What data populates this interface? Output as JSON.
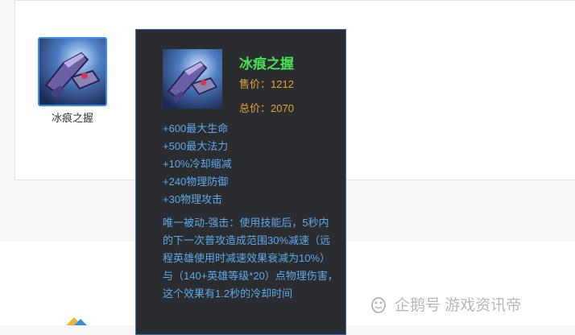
{
  "item": {
    "name": "冰痕之握",
    "icon": "ice-gauntlet-item-icon"
  },
  "tooltip": {
    "title": "冰痕之握",
    "sell_price": "售价：1212",
    "total_price": "总价：2070",
    "stats": [
      "+600最大生命",
      "+500最大法力",
      "+10%冷却缩减",
      "+240物理防御",
      "+30物理攻击"
    ],
    "passive": "唯一被动-强击：使用技能后，5秒内的下一次普攻造成范围30%减速（远程英雄使用时减速效果衰减为10%）与（140+英雄等级*20）点物理伤害，这个效果有1.2秒的冷却时间"
  },
  "watermark": {
    "text": "企鹅号 游戏资讯帝",
    "icon": "penguin-logo-icon"
  },
  "colors": {
    "title_green": "#47e05a",
    "price_gold": "#e0a43a",
    "stat_blue": "#5fa8ea",
    "tooltip_bg": "#2b2c2f",
    "highlight_border": "#3d8de6"
  }
}
